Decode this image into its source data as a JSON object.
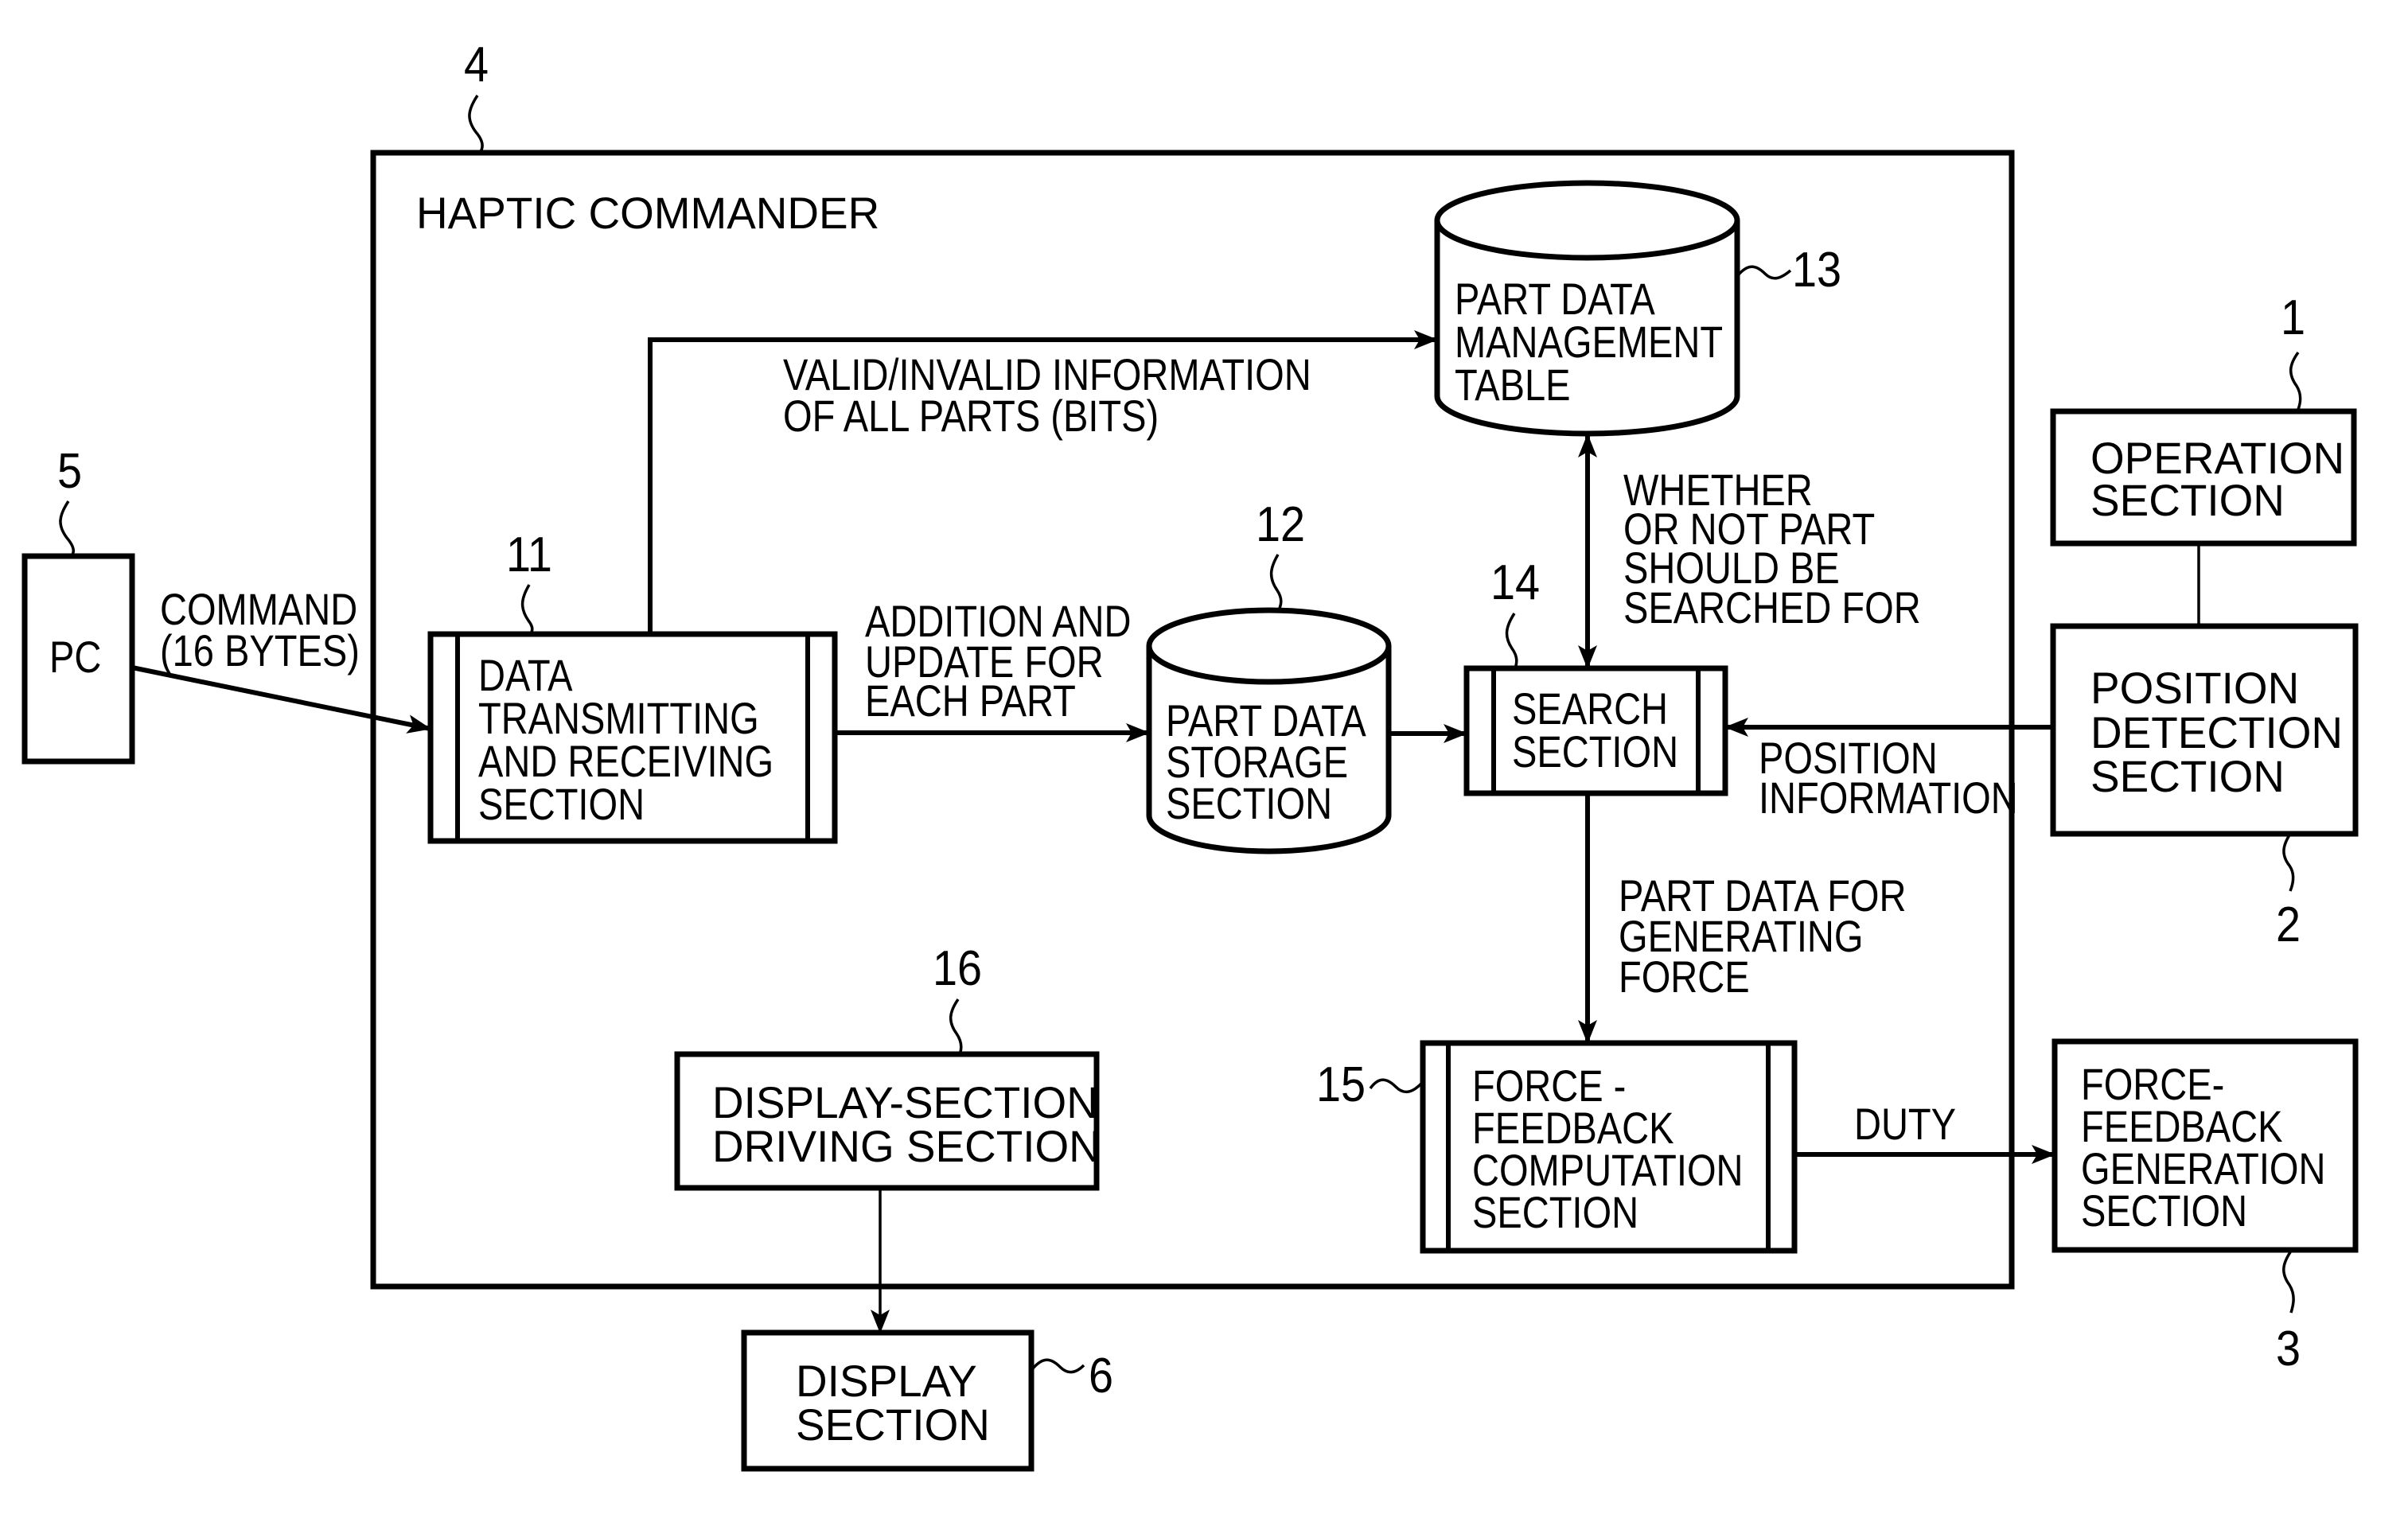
{
  "figure": {
    "title": "HAPTIC COMMANDER",
    "reference_numbers": {
      "haptic_commander": "4",
      "pc": "5",
      "data_transmitting": "11",
      "part_data_storage": "12",
      "part_data_management": "13",
      "search_section": "14",
      "force_feedback_computation": "15",
      "display_driving": "16",
      "display_section": "6",
      "operation_section": "1",
      "position_detection": "2",
      "force_feedback_generation": "3"
    },
    "blocks": {
      "pc": [
        "PC"
      ],
      "data_transmitting": [
        "DATA",
        "TRANSMITTING",
        "AND  RECEIVING",
        "SECTION"
      ],
      "part_data_storage": [
        "PART  DATA",
        "STORAGE",
        "SECTION"
      ],
      "part_data_management": [
        "PART  DATA",
        "MANAGEMENT",
        "TABLE"
      ],
      "search_section": [
        "SEARCH",
        "SECTION"
      ],
      "force_feedback_computation": [
        "FORCE -",
        "FEEDBACK",
        "COMPUTATION",
        "SECTION"
      ],
      "display_driving": [
        "DISPLAY-SECTION",
        "DRIVING  SECTION"
      ],
      "display_section": [
        "DISPLAY",
        "SECTION"
      ],
      "operation_section": [
        "OPERATION",
        "SECTION"
      ],
      "position_detection": [
        "POSITION",
        "DETECTION",
        "SECTION"
      ],
      "force_feedback_generation": [
        "FORCE-",
        "FEEDBACK",
        "GENERATION",
        "SECTION"
      ]
    },
    "edge_labels": {
      "command": [
        "COMMAND",
        "(16  BYTES)"
      ],
      "valid_invalid": [
        "VALID/INVALID  INFORMATION",
        "OF  ALL  PARTS  (BITS)"
      ],
      "addition_update": [
        "ADDITION  AND",
        "UPDATE  FOR",
        "EACH  PART"
      ],
      "whether_searched": [
        "WHETHER",
        "OR  NOT  PART",
        "SHOULD  BE",
        "SEARCHED  FOR"
      ],
      "position_information": [
        "POSITION",
        "INFORMATION"
      ],
      "part_data_force": [
        "PART  DATA  FOR",
        "GENERATING",
        "FORCE"
      ],
      "duty": [
        "DUTY"
      ]
    }
  }
}
